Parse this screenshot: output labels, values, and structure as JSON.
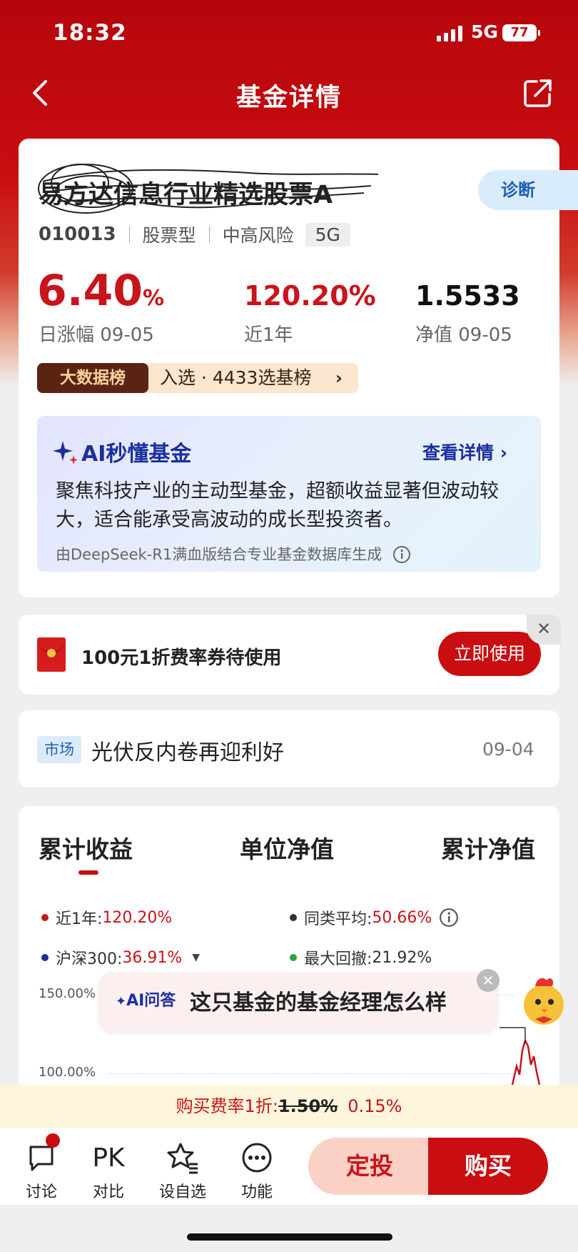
{
  "status_bar": {
    "time": "18:32",
    "network": "5G",
    "battery": "77"
  },
  "nav": {
    "title": "基金详情",
    "back_icon": "chevron-left-icon",
    "share_icon": "share-icon"
  },
  "fund": {
    "name": "易方达信息行业精选股票A",
    "diagnose_label": "诊断",
    "code": "010013",
    "type": "股票型",
    "risk": "中高风险",
    "tag": "5G",
    "daily_change_value": "6.40",
    "daily_change_unit": "%",
    "daily_change_label": "日涨幅 09-05",
    "one_year_value": "120.20%",
    "one_year_label": "近1年",
    "nav_value": "1.5533",
    "nav_label": "净值 09-05",
    "rank_badge": "大数据榜",
    "rank_text": "入选 · 4433选基榜",
    "rank_arrow": "›"
  },
  "ai_card": {
    "title": "AI秒懂基金",
    "more": "查看详情 ›",
    "body": "聚焦科技产业的主动型基金，超额收益显著但波动较大，适合能承受高波动的成长型投资者。",
    "source": "由DeepSeek-R1满血版结合专业基金数据库生成",
    "info_icon": "info-icon"
  },
  "coupon": {
    "text": "100元1折费率券待使用",
    "button": "立即使用",
    "close": "✕"
  },
  "news": {
    "tag": "市场",
    "headline": "光伏反内卷再迎利好",
    "date": "09-04"
  },
  "chart_section": {
    "tabs": [
      "累计收益",
      "单位净值",
      "累计净值"
    ],
    "active_tab": 0,
    "legend": [
      {
        "label": "近1年:",
        "value": "120.20%",
        "color": "#c8141b"
      },
      {
        "label": "同类平均:",
        "value": "50.66%",
        "color": "#333333"
      },
      {
        "label": "沪深300:",
        "value": "36.91%",
        "color": "#1c2fa0"
      },
      {
        "label": "最大回撤:",
        "value": "21.92%",
        "color": "#2aa43a"
      }
    ],
    "y_ticks": [
      "150.00%",
      "100.00%"
    ]
  },
  "ai_bubble": {
    "label": "AI问答",
    "question": "这只基金的基金经理怎么样",
    "close": "✕"
  },
  "fee_bar": {
    "prefix": "购买费率1折:",
    "old_rate": "1.50%",
    "new_rate": "0.15%"
  },
  "bottom_nav": [
    {
      "label": "讨论",
      "icon": "chat-icon"
    },
    {
      "label": "对比",
      "icon": "pk-icon",
      "icon_text": "PK"
    },
    {
      "label": "设自选",
      "icon": "star-list-icon"
    },
    {
      "label": "功能",
      "icon": "more-icon"
    }
  ],
  "actions": {
    "invest": "定投",
    "buy": "购买"
  },
  "colors": {
    "brand_red": "#c90d10",
    "ai_blue": "#1c2fa0"
  }
}
